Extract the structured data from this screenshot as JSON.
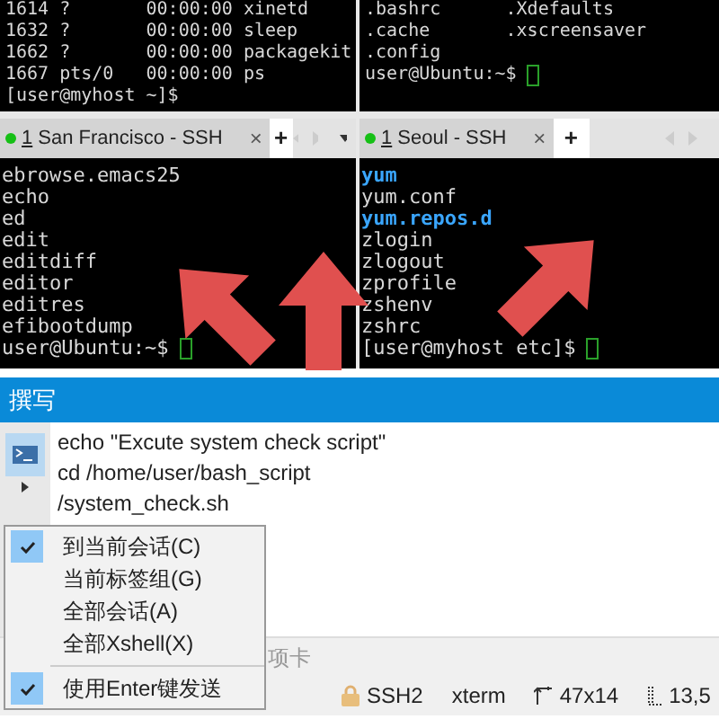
{
  "panes": [
    {
      "top_lines": [
        {
          "text": "1614 ?       00:00:00 xinetd",
          "kind": "plain"
        },
        {
          "text": "1632 ?       00:00:00 sleep",
          "kind": "plain"
        },
        {
          "text": "1662 ?       00:00:00 packagekit",
          "kind": "plain"
        },
        {
          "text": "1667 pts/0   00:00:00 ps",
          "kind": "plain"
        },
        {
          "text": "[user@myhost ~]$",
          "kind": "plain"
        }
      ],
      "tab": {
        "number": "1",
        "title": "San Francisco - SSH",
        "connected": true,
        "selected": true,
        "close": "×"
      },
      "add": "+",
      "lines": [
        {
          "text": "ebrowse.emacs25",
          "kind": "plain"
        },
        {
          "text": "echo",
          "kind": "plain"
        },
        {
          "text": "ed",
          "kind": "plain"
        },
        {
          "text": "edit",
          "kind": "plain"
        },
        {
          "text": "editdiff",
          "kind": "plain"
        },
        {
          "text": "editor",
          "kind": "plain"
        },
        {
          "text": "editres",
          "kind": "plain"
        },
        {
          "text": "efibootdump",
          "kind": "plain"
        },
        {
          "text": "user@Ubuntu:~$",
          "kind": "prompt"
        }
      ]
    },
    {
      "top_lines": [
        {
          "text": ".bashrc      .Xdefaults",
          "kind": "plain"
        },
        {
          "text": ".cache       .xscreensaver",
          "kind": "plain"
        },
        {
          "text": ".config",
          "kind": "plain"
        },
        {
          "text": "user@Ubuntu:~$",
          "kind": "prompt"
        }
      ],
      "tab": {
        "number": "1",
        "title": "Seoul - SSH",
        "connected": true,
        "selected": true,
        "close": "×"
      },
      "add": "+",
      "lines": [
        {
          "text": "yum",
          "kind": "dir"
        },
        {
          "text": "yum.conf",
          "kind": "plain"
        },
        {
          "text": "yum.repos.d",
          "kind": "dir"
        },
        {
          "text": "zlogin",
          "kind": "plain"
        },
        {
          "text": "zlogout",
          "kind": "plain"
        },
        {
          "text": "zprofile",
          "kind": "plain"
        },
        {
          "text": "zshenv",
          "kind": "plain"
        },
        {
          "text": "zshrc",
          "kind": "plain"
        },
        {
          "text": "[user@myhost etc]$",
          "kind": "prompt"
        }
      ]
    }
  ],
  "compose": {
    "title": "撰写",
    "lines": [
      "echo \"Excute system check script\"",
      "cd /home/user/bash_script",
      "/system_check.sh"
    ],
    "menu": [
      {
        "kind": "item",
        "label": "到当前会话(C)",
        "checked": true
      },
      {
        "kind": "item",
        "label": "当前标签组(G)",
        "checked": false
      },
      {
        "kind": "item",
        "label": "全部会话(A)",
        "checked": false
      },
      {
        "kind": "item",
        "label": "全部Xshell(X)",
        "checked": false
      },
      {
        "kind": "divider"
      },
      {
        "kind": "item",
        "label": "使用Enter键发送",
        "checked": true
      }
    ],
    "tab_label": "项卡"
  },
  "status_bar": [
    {
      "kind": "lock",
      "text": "SSH2"
    },
    {
      "kind": "plain",
      "text": "xterm"
    },
    {
      "kind": "size",
      "text": "47x14"
    },
    {
      "kind": "cursor",
      "text": "13,5"
    }
  ]
}
